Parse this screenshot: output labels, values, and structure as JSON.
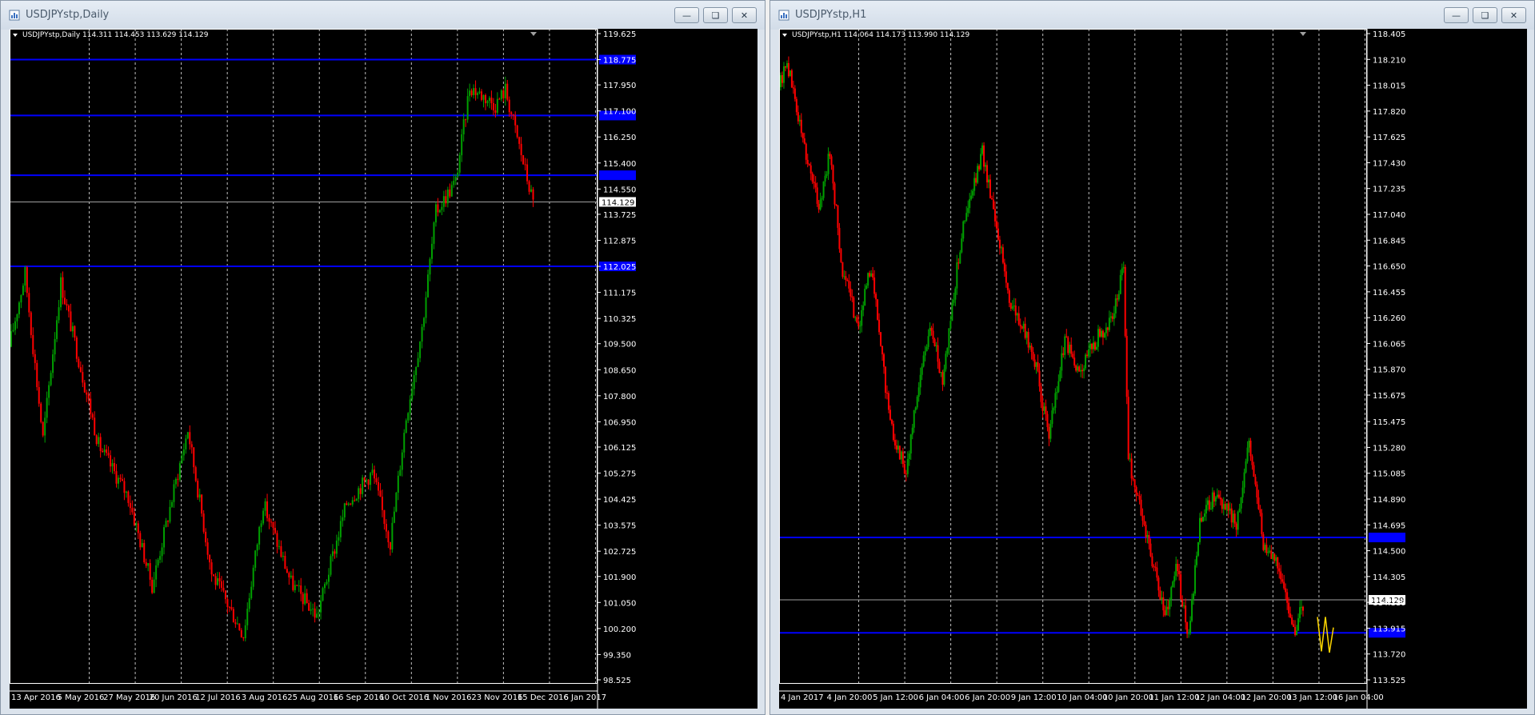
{
  "colors": {
    "bull": "#00a000",
    "bear": "#ff0000",
    "level": "#0000ff",
    "current": "#a0a0a0",
    "grid": "#c0c0c0",
    "annotation": "#ffd700"
  },
  "windows": [
    {
      "id": "daily",
      "title": "USDJPYstp,Daily",
      "info": "USDJPYstp,Daily  114.311 114.453 113.629 114.129",
      "yMax": 119.625,
      "yMin": 98.525,
      "priceLabels": [
        "119.625",
        "118.775",
        "117.950",
        "117.100",
        "116.250",
        "115.400",
        "114.550",
        "113.725",
        "112.875",
        "112.025",
        "111.175",
        "110.325",
        "109.500",
        "108.650",
        "107.800",
        "106.950",
        "106.125",
        "105.275",
        "104.425",
        "103.575",
        "102.725",
        "101.900",
        "101.050",
        "100.200",
        "99.350",
        "98.525"
      ],
      "dateLabels": [
        "13 Apr 2016",
        "5 May 2016",
        "27 May 2016",
        "20 Jun 2016",
        "12 Jul 2016",
        "3 Aug 2016",
        "25 Aug 2016",
        "16 Sep 2016",
        "10 Oct 2016",
        "1 Nov 2016",
        "23 Nov 2016",
        "15 Dec 2016",
        "6 Jan 2017"
      ],
      "levels": [
        118.775,
        116.95,
        115.0,
        112.025
      ],
      "current": 114.129,
      "currentLabel": "114.129",
      "pivots": [
        [
          0,
          109.4
        ],
        [
          8,
          111.8
        ],
        [
          17,
          106.4
        ],
        [
          26,
          111.5
        ],
        [
          45,
          106.2
        ],
        [
          60,
          104.5
        ],
        [
          72,
          101.6
        ],
        [
          90,
          106.7
        ],
        [
          102,
          102.0
        ],
        [
          118,
          100.0
        ],
        [
          128,
          104.3
        ],
        [
          142,
          101.7
        ],
        [
          155,
          100.6
        ],
        [
          170,
          104.3
        ],
        [
          183,
          105.3
        ],
        [
          192,
          103.0
        ],
        [
          200,
          107.1
        ],
        [
          208,
          110.0
        ],
        [
          215,
          113.8
        ],
        [
          225,
          114.8
        ],
        [
          232,
          117.9
        ],
        [
          245,
          117.3
        ],
        [
          250,
          117.8
        ],
        [
          264,
          114.1
        ]
      ]
    },
    {
      "id": "h1",
      "title": "USDJPYstp,H1",
      "info": "USDJPYstp,H1  114.064 114.173 113.990 114.129",
      "yMax": 118.405,
      "yMin": 113.525,
      "priceLabels": [
        "118.405",
        "118.210",
        "118.015",
        "117.820",
        "117.625",
        "117.430",
        "117.235",
        "117.040",
        "116.845",
        "116.650",
        "116.455",
        "116.260",
        "116.065",
        "115.870",
        "115.675",
        "115.475",
        "115.280",
        "115.085",
        "114.890",
        "114.695",
        "114.500",
        "114.305",
        "114.110",
        "113.915",
        "113.720",
        "113.525"
      ],
      "dateLabels": [
        "4 Jan 2017",
        "4 Jan 20:00",
        "5 Jan 12:00",
        "6 Jan 04:00",
        "6 Jan 20:00",
        "9 Jan 12:00",
        "10 Jan 04:00",
        "10 Jan 20:00",
        "11 Jan 12:00",
        "12 Jan 04:00",
        "12 Jan 20:00",
        "13 Jan 12:00",
        "16 Jan 04:00"
      ],
      "levels": [
        114.6,
        113.88
      ],
      "current": 114.129,
      "currentLabel": "114.129",
      "pivots": [
        [
          0,
          118.0
        ],
        [
          5,
          118.2
        ],
        [
          15,
          117.6
        ],
        [
          25,
          117.1
        ],
        [
          32,
          117.5
        ],
        [
          40,
          116.6
        ],
        [
          50,
          116.2
        ],
        [
          58,
          116.65
        ],
        [
          70,
          115.45
        ],
        [
          80,
          115.1
        ],
        [
          88,
          115.75
        ],
        [
          95,
          116.2
        ],
        [
          103,
          115.8
        ],
        [
          115,
          116.9
        ],
        [
          128,
          117.5
        ],
        [
          135,
          117.1
        ],
        [
          145,
          116.4
        ],
        [
          160,
          116.0
        ],
        [
          170,
          115.35
        ],
        [
          180,
          116.1
        ],
        [
          188,
          115.85
        ],
        [
          200,
          116.1
        ],
        [
          210,
          116.25
        ],
        [
          217,
          116.65
        ],
        [
          220,
          115.2
        ],
        [
          230,
          114.7
        ],
        [
          243,
          114.0
        ],
        [
          250,
          114.4
        ],
        [
          258,
          113.85
        ],
        [
          265,
          114.7
        ],
        [
          275,
          114.95
        ],
        [
          288,
          114.7
        ],
        [
          296,
          115.35
        ],
        [
          305,
          114.55
        ],
        [
          315,
          114.35
        ],
        [
          325,
          113.9
        ],
        [
          330,
          114.1
        ]
      ],
      "annotation": [
        [
          113.91,
          114.0
        ],
        [
          113.89,
          113.74
        ],
        [
          114.02,
          114.0
        ],
        [
          114.12,
          113.73
        ],
        [
          113.97,
          113.92
        ]
      ]
    }
  ]
}
